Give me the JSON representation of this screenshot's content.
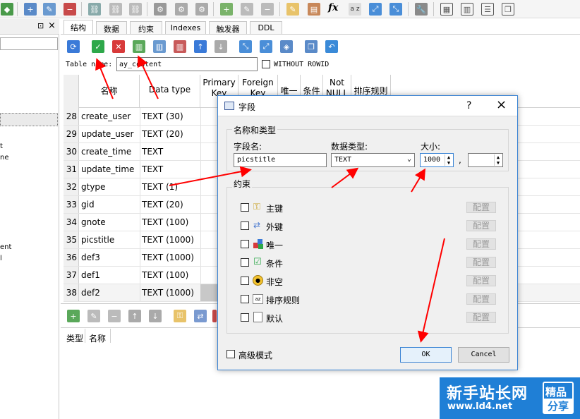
{
  "tabs": [
    {
      "label": "结构"
    },
    {
      "label": "数据"
    },
    {
      "label": "约束"
    },
    {
      "label": "Indexes"
    },
    {
      "label": "触发器"
    },
    {
      "label": "DDL"
    }
  ],
  "left_panel": {
    "pin_glyph": "ð ×",
    "fragments": [
      "t",
      "ne",
      "ent",
      "l"
    ]
  },
  "table_name": {
    "label": "Table name:",
    "value": "ay_content",
    "without_rowid": "WITHOUT ROWID"
  },
  "grid": {
    "headers": [
      "名称",
      "Data type",
      "Primary Key",
      "Foreign Key",
      "唯一",
      "条件",
      "Not NULL",
      "排序规则"
    ],
    "rows": [
      {
        "num": "28",
        "name": "create_user",
        "type": "TEXT (30)"
      },
      {
        "num": "29",
        "name": "update_user",
        "type": "TEXT (20)"
      },
      {
        "num": "30",
        "name": "create_time",
        "type": "TEXT"
      },
      {
        "num": "31",
        "name": "update_time",
        "type": "TEXT"
      },
      {
        "num": "32",
        "name": "gtype",
        "type": "TEXT (1)"
      },
      {
        "num": "33",
        "name": "gid",
        "type": "TEXT (20)"
      },
      {
        "num": "34",
        "name": "gnote",
        "type": "TEXT (100)"
      },
      {
        "num": "35",
        "name": "picstitle",
        "type": "TEXT (1000)"
      },
      {
        "num": "36",
        "name": "def3",
        "type": "TEXT (1000)"
      },
      {
        "num": "37",
        "name": "def1",
        "type": "TEXT (100)"
      },
      {
        "num": "38",
        "name": "def2",
        "type": "TEXT (1000)"
      }
    ]
  },
  "lower": {
    "col_type": "类型",
    "col_name": "名称"
  },
  "dialog": {
    "title": "字段",
    "help": "?",
    "group_name_type": "名称和类型",
    "field_name_label": "字段名:",
    "field_name_value": "picstitle",
    "data_type_label": "数据类型:",
    "data_type_value": "TEXT",
    "size_label": "大小:",
    "size_value": "1000",
    "comma": ",",
    "constraints_label": "约束",
    "constraints": [
      {
        "label": "主键",
        "icon": "key-icon"
      },
      {
        "label": "外键",
        "icon": "foreign-key-icon"
      },
      {
        "label": "唯一",
        "icon": "unique-icon"
      },
      {
        "label": "条件",
        "icon": "check-condition-icon"
      },
      {
        "label": "非空",
        "icon": "not-null-icon"
      },
      {
        "label": "排序规则",
        "icon": "collation-icon"
      },
      {
        "label": "默认",
        "icon": "default-value-icon"
      }
    ],
    "config_label": "配置",
    "advanced_mode": "高级模式",
    "ok": "OK",
    "cancel": "Cancel"
  },
  "watermark": {
    "main": "新手站长网",
    "url": "www.ld4.net",
    "badge1": "精品",
    "badge2": "分享"
  },
  "colors": {
    "accent": "#3b84d4",
    "arrow": "#ff0000",
    "watermark_bg": "#1f7fd6"
  }
}
